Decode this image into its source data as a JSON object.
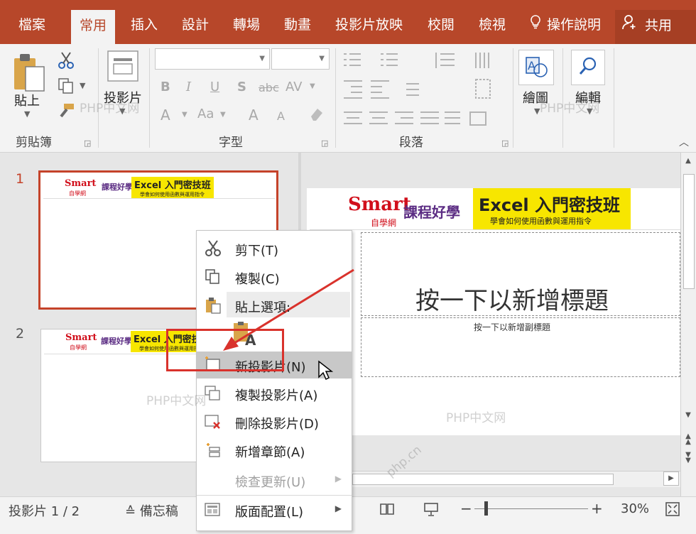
{
  "tabs": [
    "檔案",
    "常用",
    "插入",
    "設計",
    "轉場",
    "動畫",
    "投影片放映",
    "校閱",
    "檢視"
  ],
  "active_tab": "常用",
  "tell_me": "操作說明",
  "share": "共用",
  "ribbon": {
    "paste_label": "貼上",
    "clipboard_group": "剪貼簿",
    "slides_label": "投影片",
    "font_group": "字型",
    "paragraph_group": "段落",
    "drawing_label": "繪圖",
    "editing_label": "編輯",
    "font_buttons": [
      "B",
      "I",
      "U",
      "S",
      "abc",
      "AV",
      "A",
      "Aa",
      "A",
      "A"
    ]
  },
  "thumbnails": [
    {
      "number": "1",
      "selected": true
    },
    {
      "number": "2",
      "selected": false
    }
  ],
  "banner": {
    "brand": "Smart",
    "brand_sub": "自學網",
    "course": "課程好學",
    "title": "Excel 入門密技班",
    "subtitle": "學會如何使用函數與運用指令"
  },
  "slide": {
    "title_placeholder": "按一下以新增標題",
    "subtitle_placeholder": "按一下以新增副標題"
  },
  "context_menu": {
    "items": [
      {
        "label": "剪下(T)",
        "icon": "scissors-icon",
        "disabled": false
      },
      {
        "label": "複製(C)",
        "icon": "copy-icon",
        "disabled": false
      },
      {
        "label": "貼上選項:",
        "icon": "paste-icon",
        "disabled": false
      },
      {
        "label": "新投影片(N)",
        "icon": "new-slide-icon",
        "disabled": false
      },
      {
        "label": "複製投影片(A)",
        "icon": "duplicate-slide-icon",
        "disabled": false
      },
      {
        "label": "刪除投影片(D)",
        "icon": "delete-slide-icon",
        "disabled": false
      },
      {
        "label": "新增章節(A)",
        "icon": "add-section-icon",
        "disabled": false
      },
      {
        "label": "檢查更新(U)",
        "icon": "none",
        "disabled": true
      },
      {
        "label": "版面配置(L)",
        "icon": "layout-icon",
        "disabled": false
      }
    ],
    "paste_keep_text": "A"
  },
  "status": {
    "slide_counter": "投影片 1 / 2",
    "notes_label": "備忘稿",
    "zoom": "30%"
  },
  "watermarks": [
    "PHP中文网",
    "PHP中文网",
    "PHP中文网",
    "PHP中文网",
    "php.cn"
  ],
  "colors": {
    "accent": "#b7472a",
    "highlight": "#c5432a",
    "annotation": "#d9322c",
    "banner_yellow": "#f7e600",
    "brand_red": "#d10f1b"
  }
}
